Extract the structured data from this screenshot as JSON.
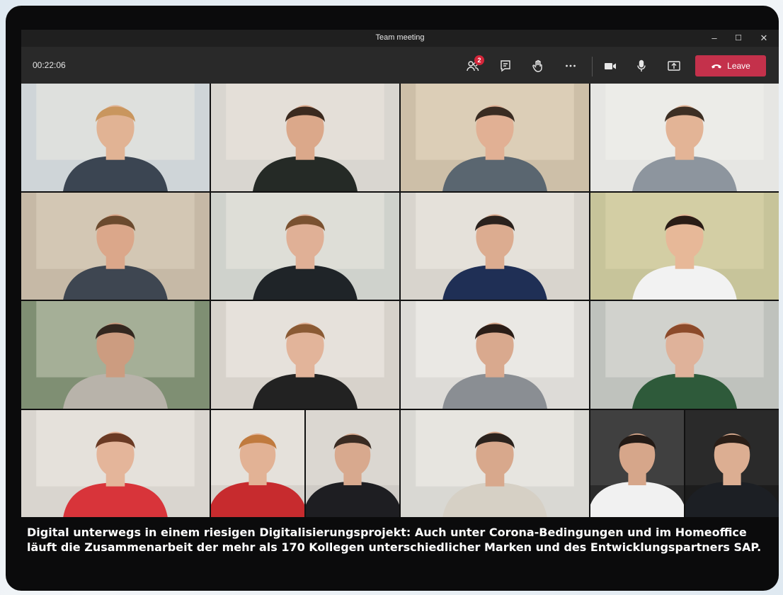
{
  "window": {
    "title": "Team meeting",
    "controls": {
      "minimize": "–",
      "maximize": "☐",
      "close": "✕"
    }
  },
  "toolbar": {
    "timer": "00:22:06",
    "participants_badge": "2",
    "leave_label": "Leave",
    "icons": [
      "participants-icon",
      "chat-icon",
      "raise-hand-icon",
      "more-icon",
      "camera-icon",
      "microphone-icon",
      "share-screen-icon",
      "phone-hangup-icon"
    ]
  },
  "colors": {
    "leave": "#c4314b",
    "badge": "#d4263a",
    "window_bg": "#292929",
    "titlebar_bg": "#1f1f1f"
  },
  "video_tiles": [
    {
      "bg": "#cfd5d8",
      "wall": "#e4e4df",
      "shirt": "#3b4552",
      "skin": "#e1b394",
      "hair": "#c9965e"
    },
    {
      "bg": "#d9d6d0",
      "wall": "#e8e3dc",
      "shirt": "#252a26",
      "skin": "#dba88a",
      "hair": "#3b2a1f"
    },
    {
      "bg": "#cdbfa8",
      "wall": "#e2d4be",
      "shirt": "#5a6670",
      "skin": "#e1b094",
      "hair": "#3a2c22"
    },
    {
      "bg": "#e6e6e3",
      "wall": "#eeeeea",
      "shirt": "#8d959e",
      "skin": "#e3b496",
      "hair": "#3d2f24"
    },
    {
      "bg": "#c6b9a6",
      "wall": "#d9cdbb",
      "shirt": "#3e4651",
      "skin": "#dba78a",
      "hair": "#6b4a2e"
    },
    {
      "bg": "#cfd2cc",
      "wall": "#e4e3dc",
      "shirt": "#1f2428",
      "skin": "#e0b096",
      "hair": "#7a5130"
    },
    {
      "bg": "#d8d4cd",
      "wall": "#ebe7e0",
      "shirt": "#1f2f55",
      "skin": "#dcac90",
      "hair": "#2b221d"
    },
    {
      "bg": "#c7c49a",
      "wall": "#d8d3a8",
      "shirt": "#f2f2f2",
      "skin": "#e7b898",
      "hair": "#2a1c15"
    },
    {
      "bg": "#7f8f73",
      "wall": "#b5bca6",
      "shirt": "#b8b3aa",
      "skin": "#cc9c80",
      "hair": "#33271f"
    },
    {
      "bg": "#d7d2cb",
      "wall": "#ece7e1",
      "shirt": "#222222",
      "skin": "#e2b49a",
      "hair": "#8a5a34"
    },
    {
      "bg": "#dddbd7",
      "wall": "#f0eeea",
      "shirt": "#8a8e93",
      "skin": "#d9a98e",
      "hair": "#2a1d17"
    },
    {
      "bg": "#bfc2bd",
      "wall": "#d9d9d4",
      "shirt": "#2e5a3a",
      "skin": "#dfb29a",
      "hair": "#8c4a2a"
    },
    {
      "bg": "#d9d5cf",
      "wall": "#eae6e0",
      "shirt": "#d8343a",
      "skin": "#e4b59a",
      "hair": "#6a3a24"
    },
    {
      "bg": "#d9d8d3",
      "wall": "#ecebe6",
      "shirt": "#d6d0c5",
      "skin": "#d8a88c",
      "hair": "#2b221d"
    }
  ],
  "video_tiles_split": [
    [
      {
        "bg": "#d7d2cc",
        "wall": "#ebe7e1",
        "shirt": "#c72b2e",
        "skin": "#e2b295",
        "hair": "#c07a3e"
      },
      {
        "bg": "#cfcbc6",
        "wall": "#e0dcd6",
        "shirt": "#1e1e22",
        "skin": "#d8a98e",
        "hair": "#3a2b22"
      }
    ],
    [
      {
        "bg": "#2b2b2b",
        "wall": "#4a4a4a",
        "shirt": "#f1f1f1",
        "skin": "#d6a68a",
        "hair": "#231a15"
      },
      {
        "bg": "#1c1c1c",
        "wall": "#303030",
        "shirt": "#1c1f24",
        "skin": "#dcae92",
        "hair": "#2a1e17"
      }
    ]
  ],
  "caption": {
    "line1": "Digital unterwegs in einem riesigen Digitalisierungsprojekt: Auch unter Corona-Bedingungen und im Homeoffice",
    "line2": "läuft die Zusammenarbeit der mehr als 170 Kollegen unterschiedlicher Marken und des Entwicklungspartners SAP."
  }
}
